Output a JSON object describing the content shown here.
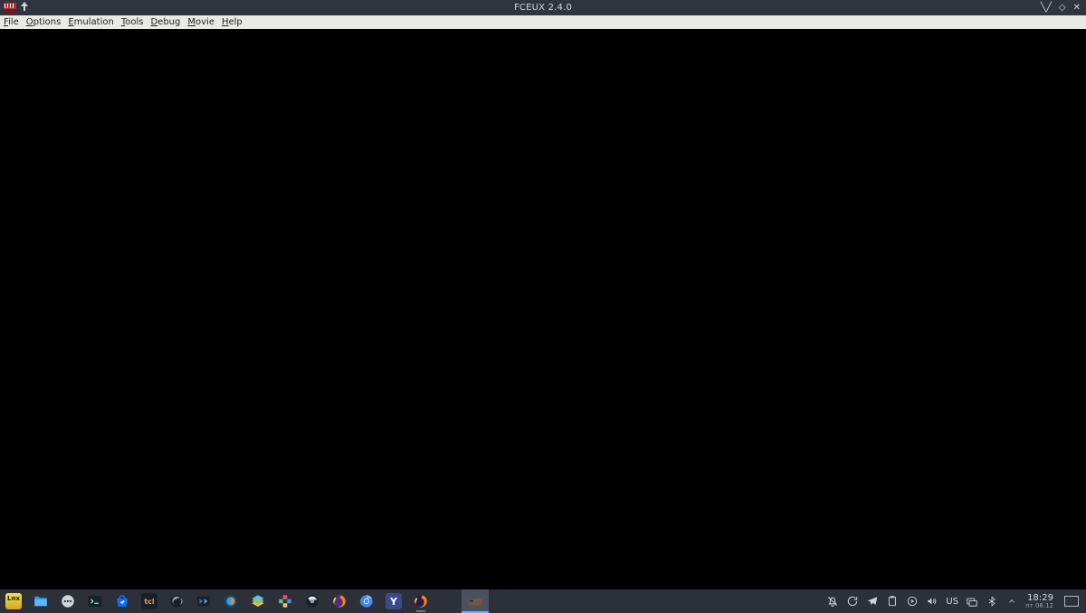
{
  "window": {
    "title": "FCEUX 2.4.0"
  },
  "menubar": {
    "items": [
      {
        "label_pre": "",
        "accel": "F",
        "label_post": "ile"
      },
      {
        "label_pre": "",
        "accel": "O",
        "label_post": "ptions"
      },
      {
        "label_pre": "",
        "accel": "E",
        "label_post": "mulation"
      },
      {
        "label_pre": "",
        "accel": "T",
        "label_post": "ools"
      },
      {
        "label_pre": "",
        "accel": "D",
        "label_post": "ebug"
      },
      {
        "label_pre": "",
        "accel": "M",
        "label_post": "ovie"
      },
      {
        "label_pre": "",
        "accel": "H",
        "label_post": "elp"
      }
    ]
  },
  "taskbar": {
    "launchers": [
      {
        "name": "start-menu-icon",
        "color": "#e8d23a"
      },
      {
        "name": "file-manager-icon",
        "color": "#2196f3"
      },
      {
        "name": "apps-overview-icon",
        "color": "#cfd3da"
      },
      {
        "name": "terminal-icon",
        "color": "#2a2e36"
      },
      {
        "name": "store-icon",
        "color": "#0d6efd"
      },
      {
        "name": "tcl-icon",
        "color": "#b07030"
      },
      {
        "name": "obs-icon",
        "color": "#333a44"
      },
      {
        "name": "kdenlive-icon",
        "color": "#3a6ea5"
      },
      {
        "name": "onlyoffice-icon",
        "color": "#2aa8e0"
      },
      {
        "name": "layers-icon",
        "color": "#ff9f1a"
      },
      {
        "name": "snip-icon",
        "color": "#e05563"
      },
      {
        "name": "chromium-c-icon",
        "color": "#e9e9e6"
      },
      {
        "name": "firefox-icon",
        "color": "#ff7f1a"
      },
      {
        "name": "chromium-icon",
        "color": "#4285f4"
      },
      {
        "name": "yandex-icon",
        "color": "#ffffff"
      },
      {
        "name": "firefox-dev-icon",
        "color": "#ff7f1a"
      }
    ],
    "running_task": {
      "name": "fceux-task-icon",
      "active": true
    },
    "tray": {
      "icons": [
        "notifications-icon",
        "sync-icon",
        "telegram-icon",
        "clipboard-icon",
        "media-icon",
        "volume-icon"
      ],
      "keyboard_layout": "US",
      "extra_icons": [
        "network-icon",
        "bluetooth-icon",
        "tray-expand-icon"
      ]
    },
    "clock": {
      "time": "18:29",
      "date": "пт 08.12"
    }
  }
}
